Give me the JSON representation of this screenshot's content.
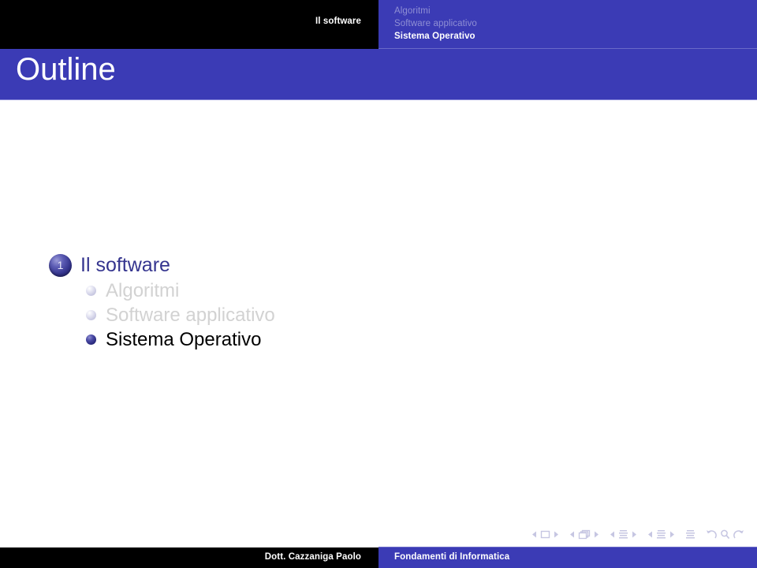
{
  "header": {
    "section": "Il software",
    "subsections": [
      {
        "label": "Algoritmi",
        "state": "dim"
      },
      {
        "label": "Software applicativo",
        "state": "dim"
      },
      {
        "label": "Sistema Operativo",
        "state": "active"
      }
    ]
  },
  "title": "Outline",
  "outline": {
    "section": {
      "number": "1",
      "label": "Il software"
    },
    "subsections": [
      {
        "label": "Algoritmi",
        "state": "dim"
      },
      {
        "label": "Software applicativo",
        "state": "dim"
      },
      {
        "label": "Sistema Operativo",
        "state": "active"
      }
    ]
  },
  "navsymbols": [
    {
      "name": "slide-prev-icon",
      "glyph": "◂"
    },
    {
      "name": "slide-icon",
      "glyph": "□"
    },
    {
      "name": "slide-next-icon",
      "glyph": "▸"
    },
    {
      "name": "frame-prev-icon",
      "glyph": "◂"
    },
    {
      "name": "frame-icon",
      "glyph": "❐"
    },
    {
      "name": "frame-next-icon",
      "glyph": "▸"
    },
    {
      "name": "subsection-prev-icon",
      "glyph": "◂"
    },
    {
      "name": "subsection-icon",
      "glyph": "≡"
    },
    {
      "name": "subsection-next-icon",
      "glyph": "▸"
    },
    {
      "name": "section-prev-icon",
      "glyph": "◂"
    },
    {
      "name": "section-icon",
      "glyph": "≡"
    },
    {
      "name": "section-next-icon",
      "glyph": "▸"
    },
    {
      "name": "presentation-icon",
      "glyph": "≡"
    },
    {
      "name": "back-icon",
      "glyph": "↶"
    },
    {
      "name": "search-icon",
      "glyph": "⚲"
    },
    {
      "name": "forward-icon",
      "glyph": "↷"
    }
  ],
  "footer": {
    "author": "Dott. Cazzaniga Paolo",
    "title": "Fondamenti di Informatica"
  },
  "colors": {
    "beamer_blue": "#3b3bb5",
    "section_dark_blue": "#35358f",
    "black_bar": "#000000",
    "dim_text": "#d2d2d2",
    "dim_nav_text": "#8f8fd4"
  }
}
